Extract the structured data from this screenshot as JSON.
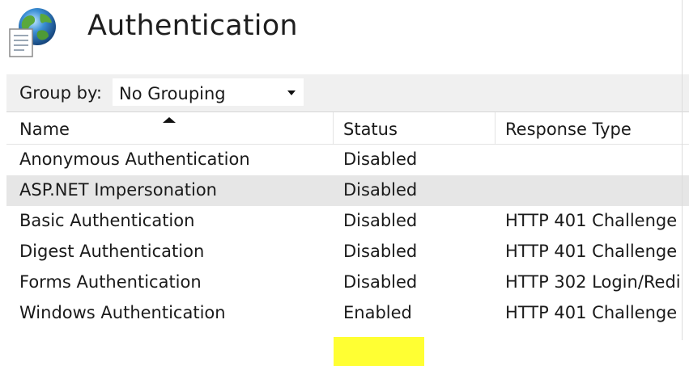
{
  "header": {
    "title": "Authentication",
    "icon": "authentication-globe-document-icon"
  },
  "toolbar": {
    "group_by_label": "Group by:",
    "group_by_value": "No Grouping"
  },
  "grid": {
    "columns": [
      "Name",
      "Status",
      "Response Type"
    ],
    "sort_column": "Name",
    "sort_direction": "ascending",
    "rows": [
      {
        "name": "Anonymous Authentication",
        "status": "Disabled",
        "response": ""
      },
      {
        "name": "ASP.NET Impersonation",
        "status": "Disabled",
        "response": ""
      },
      {
        "name": "Basic Authentication",
        "status": "Disabled",
        "response": "HTTP 401 Challenge"
      },
      {
        "name": "Digest Authentication",
        "status": "Disabled",
        "response": "HTTP 401 Challenge"
      },
      {
        "name": "Forms Authentication",
        "status": "Disabled",
        "response": "HTTP 302 Login/Redi"
      },
      {
        "name": "Windows Authentication",
        "status": "Enabled",
        "response": "HTTP 401 Challenge"
      }
    ],
    "selected_row": "ASP.NET Impersonation",
    "highlighted_cell": "Enabled"
  },
  "colors": {
    "highlight": "#ffff33",
    "selected_row": "#e6e6e6",
    "toolbar_bg": "#f0f0f0"
  }
}
